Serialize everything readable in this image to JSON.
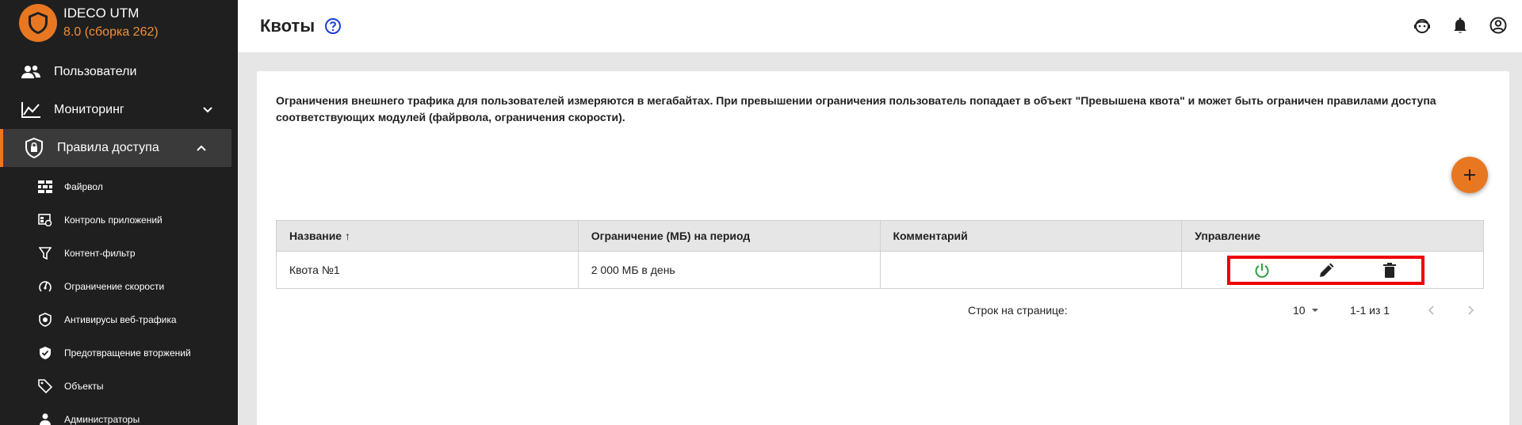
{
  "brand": {
    "name": "IDECO UTM",
    "version": "8.0 (сборка 262)"
  },
  "sidebar": {
    "items": [
      {
        "label": "Пользователи"
      },
      {
        "label": "Мониторинг"
      },
      {
        "label": "Правила доступа"
      }
    ],
    "subitems": [
      {
        "label": "Файрвол"
      },
      {
        "label": "Контроль приложений"
      },
      {
        "label": "Контент-фильтр"
      },
      {
        "label": "Ограничение скорости"
      },
      {
        "label": "Антивирусы веб-трафика"
      },
      {
        "label": "Предотвращение вторжений"
      },
      {
        "label": "Объекты"
      },
      {
        "label": "Администраторы"
      }
    ]
  },
  "header": {
    "title": "Квоты"
  },
  "main": {
    "description": "Ограничения внешнего трафика для пользователей измеряются в мегабайтах. При превышении ограничения пользователь попадает в объект \"Превышена квота\" и может быть ограничен правилами доступа соответствующих модулей (файрвола, ограничения скорости).",
    "table": {
      "columns": [
        "Название ↑",
        "Ограничение (МБ) на период",
        "Комментарий",
        "Управление"
      ],
      "rows": [
        {
          "name": "Квота №1",
          "limit": "2 000 МБ в день",
          "comment": ""
        }
      ]
    },
    "pagination": {
      "rows_label": "Строк на странице:",
      "rows_value": "10",
      "range": "1-1 из 1"
    }
  },
  "colors": {
    "accent": "#e87722",
    "sidebar_bg": "#1f1f1f",
    "highlight": "#ee0000",
    "power_green": "#2e9e3e"
  }
}
